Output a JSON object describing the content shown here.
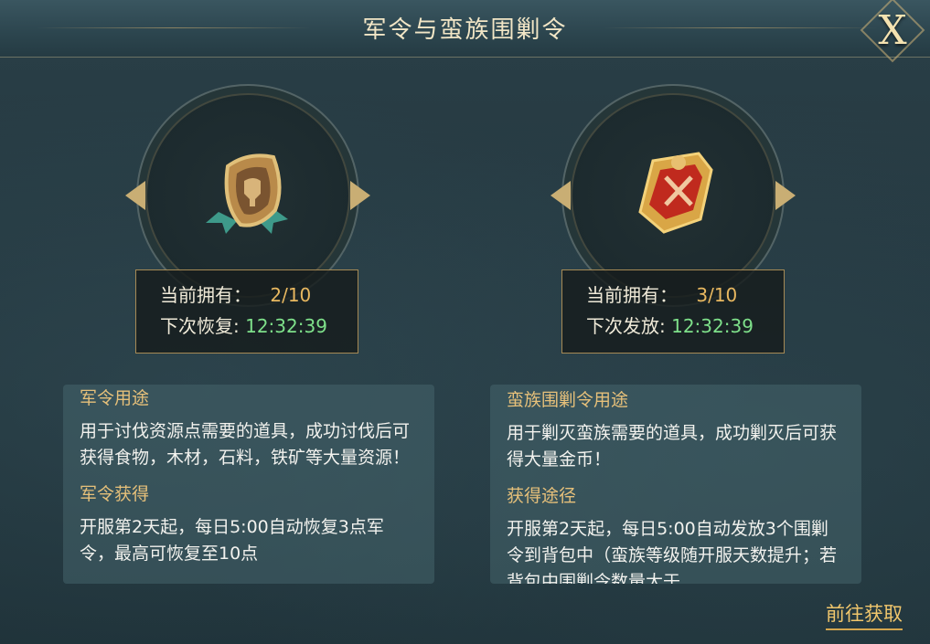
{
  "window": {
    "title": "军令与蛮族围剿令",
    "close_label": "X"
  },
  "items": [
    {
      "icon": "army-order-shield-icon",
      "owned_label": "当前拥有：",
      "owned_value": "2/10",
      "timer_label": "下次恢复:",
      "timer_value": "12:32:39",
      "usage_title": "军令用途",
      "usage_text": "用于讨伐资源点需要的道具，成功讨伐后可获得食物，木材，石料，铁矿等大量资源！",
      "obtain_title": "军令获得",
      "obtain_text": "开服第2天起，每日5:00自动恢复3点军令，最高可恢复至10点"
    },
    {
      "icon": "barbarian-suppression-order-icon",
      "owned_label": "当前拥有：",
      "owned_value": "3/10",
      "timer_label": "下次发放:",
      "timer_value": "12:32:39",
      "usage_title": "蛮族围剿令用途",
      "usage_text": "用于剿灭蛮族需要的道具，成功剿灭后可获得大量金币！",
      "obtain_title": "获得途径",
      "obtain_text": "开服第2天起，每日5:00自动发放3个围剿令到背包中（蛮族等级随开服天数提升；若背包中围剿令数量大于"
    }
  ],
  "footer": {
    "goto_label": "前往获取"
  },
  "colors": {
    "accent_gold": "#e6c07a",
    "value_orange": "#e8b860",
    "timer_green": "#7ee08a"
  }
}
